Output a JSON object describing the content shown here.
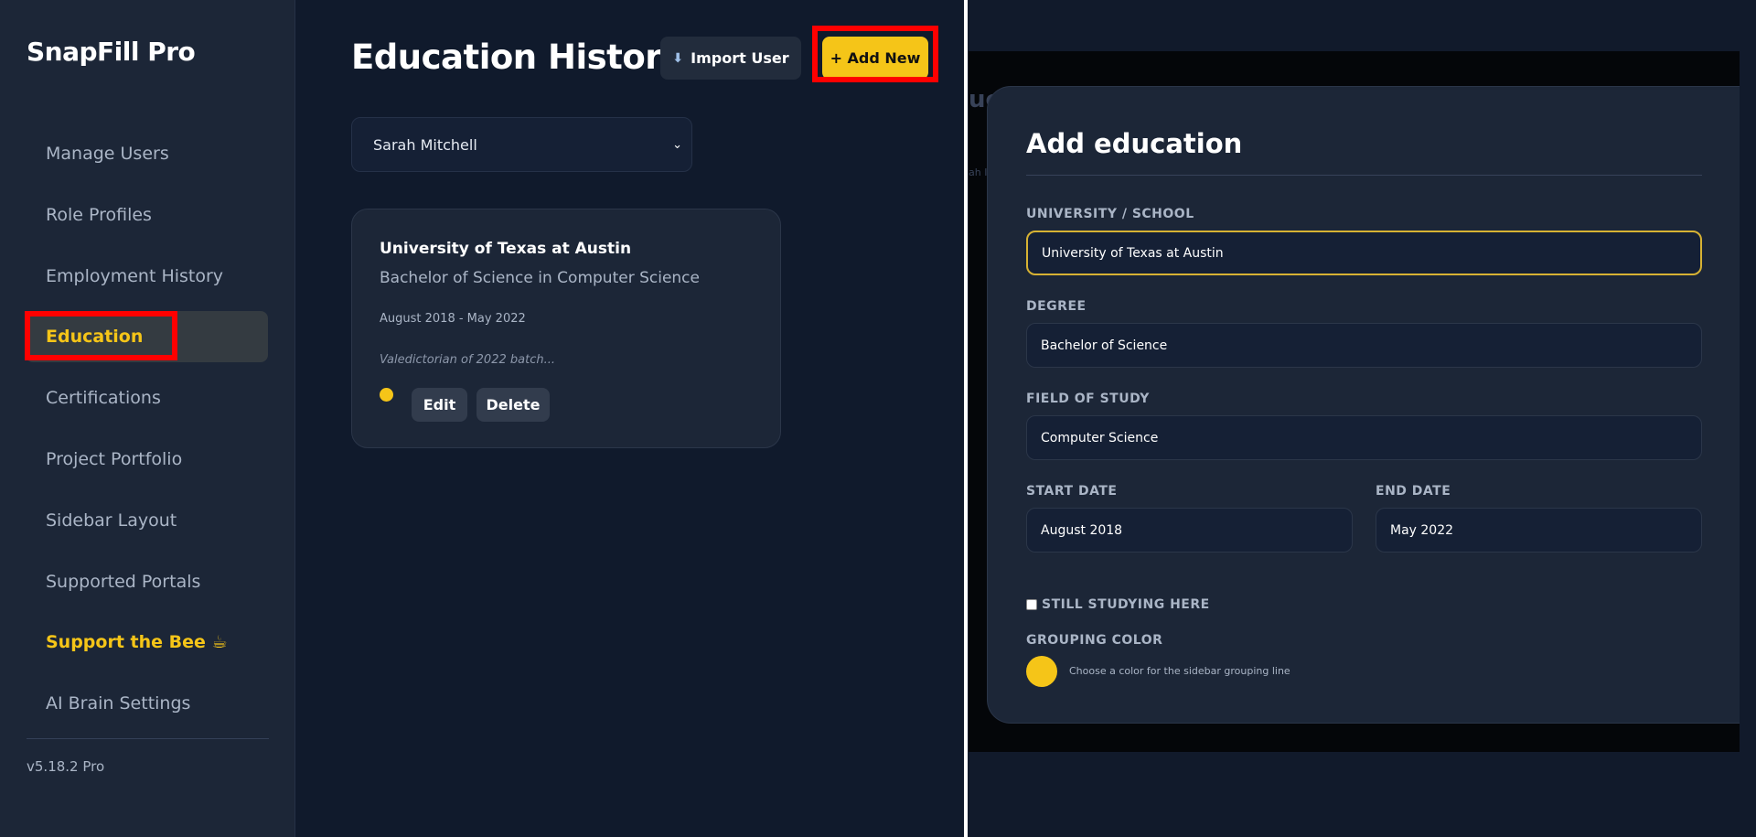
{
  "app": {
    "name": "SnapFill Pro",
    "version": "v5.18.2 Pro"
  },
  "sidebar": {
    "items": [
      {
        "label": "Manage Users",
        "active": false
      },
      {
        "label": "Role Profiles",
        "active": false
      },
      {
        "label": "Employment History",
        "active": false
      },
      {
        "label": "Education",
        "active": true
      },
      {
        "label": "Certifications",
        "active": false
      },
      {
        "label": "Project Portfolio",
        "active": false
      },
      {
        "label": "Sidebar Layout",
        "active": false
      },
      {
        "label": "Supported Portals",
        "active": false
      },
      {
        "label": "Support the Bee ☕",
        "active": false
      },
      {
        "label": "AI Brain Settings",
        "active": false
      }
    ]
  },
  "header": {
    "title": "Education History",
    "import_label": "Import User",
    "import_icon": "import-user-icon",
    "add_label": "+ Add New"
  },
  "user_select": {
    "value": "Sarah Mitchell"
  },
  "education_card": {
    "school": "University of Texas at Austin",
    "degree": "Bachelor of Science in Computer Science",
    "dates": "August 2018 - May 2022",
    "description": "Valedictorian of 2022 batch...",
    "group_color": "#f5c518",
    "edit_label": "Edit",
    "delete_label": "Delete"
  },
  "modal": {
    "title": "Add education",
    "university_label": "UNIVERSITY / SCHOOL",
    "university_value": "University of Texas at Austin",
    "degree_label": "DEGREE",
    "degree_value": "Bachelor of Science",
    "field_label": "FIELD OF STUDY",
    "field_value": "Computer Science",
    "start_label": "START DATE",
    "start_value": "August 2018",
    "end_label": "END DATE",
    "end_value": "May 2022",
    "still_studying_label": "STILL STUDYING HERE",
    "still_studying_checked": false,
    "grouping_label": "GROUPING COLOR",
    "grouping_color": "#f5c518",
    "grouping_hint": "Choose a color for the sidebar grouping line"
  },
  "colors": {
    "accent": "#f5c518",
    "highlight": "#ff0000"
  }
}
